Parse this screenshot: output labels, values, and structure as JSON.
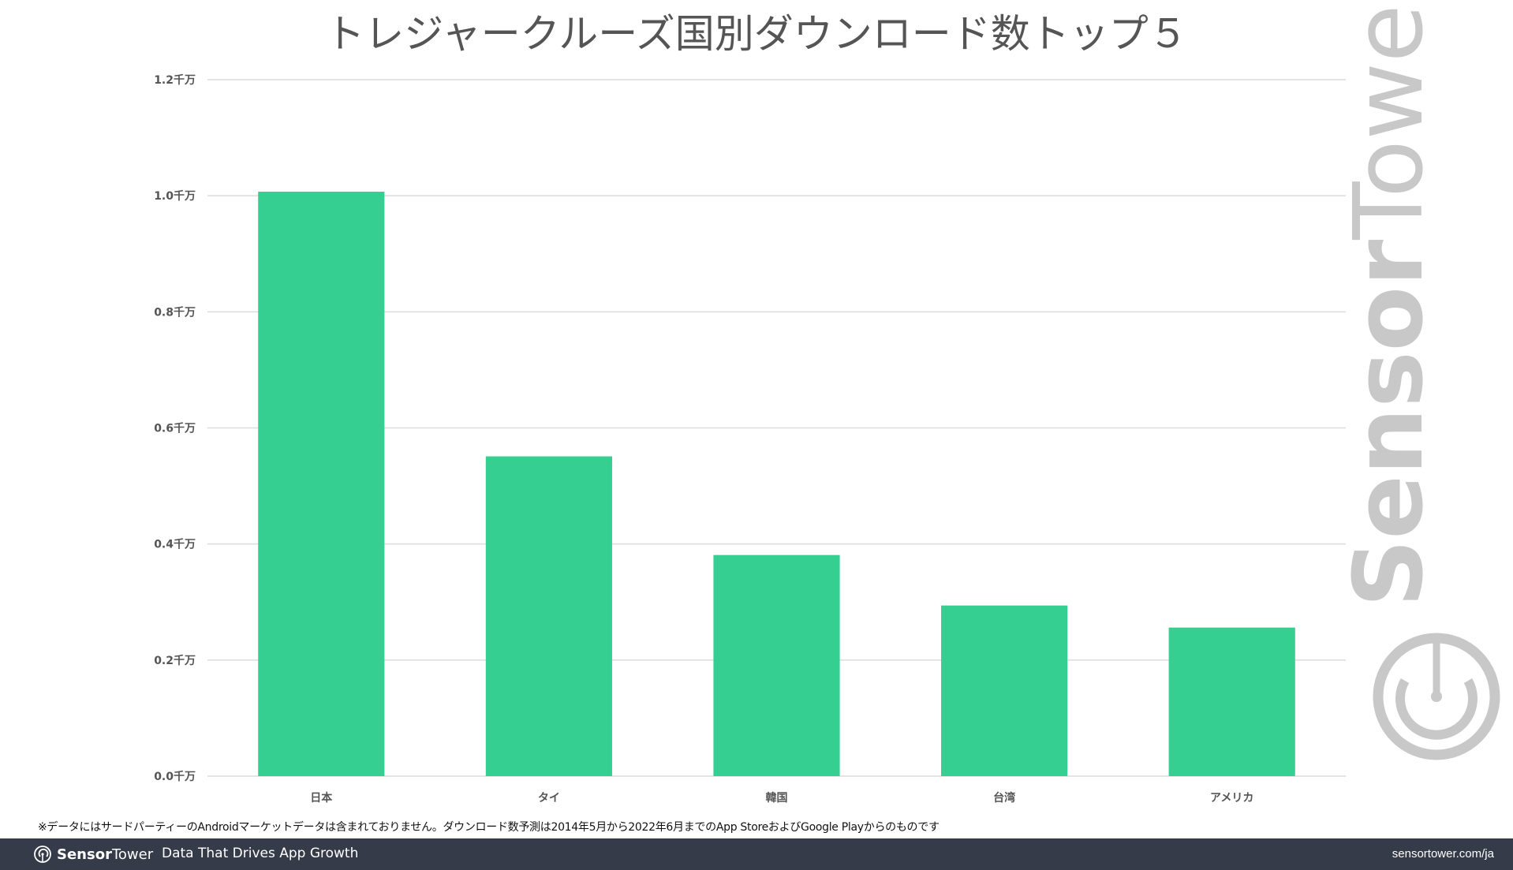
{
  "chart_data": {
    "type": "bar",
    "title": "トレジャークルーズ国別ダウンロード数トップ５",
    "categories": [
      "日本",
      "タイ",
      "韓国",
      "台湾",
      "アメリカ"
    ],
    "values": [
      1.007,
      0.551,
      0.381,
      0.294,
      0.256
    ],
    "unit": "千万",
    "xlabel": "",
    "ylabel": "",
    "ylim": [
      0,
      1.2
    ],
    "yticks": [
      0.0,
      0.2,
      0.4,
      0.6,
      0.8,
      1.0,
      1.2
    ],
    "ytick_labels": [
      "0.0千万",
      "0.2千万",
      "0.4千万",
      "0.6千万",
      "0.8千万",
      "1.0千万",
      "1.2千万"
    ],
    "grid": true,
    "legend": "none",
    "bar_color": "#36cf92"
  },
  "footnote": "※データにはサードパーティーのAndroidマーケットデータは含まれておりません。ダウンロード数予測は2014年5月から2022年6月までのApp StoreおよびGoogle Playからのものです",
  "watermark": {
    "bold": "Sensor",
    "light": "Tower",
    "icon": "sensor-tower-logo-icon"
  },
  "footer": {
    "brand_bold": "Sensor",
    "brand_light": "Tower",
    "tagline": "Data That Drives App Growth",
    "url": "sensortower.com/ja",
    "background": "#353b48"
  }
}
